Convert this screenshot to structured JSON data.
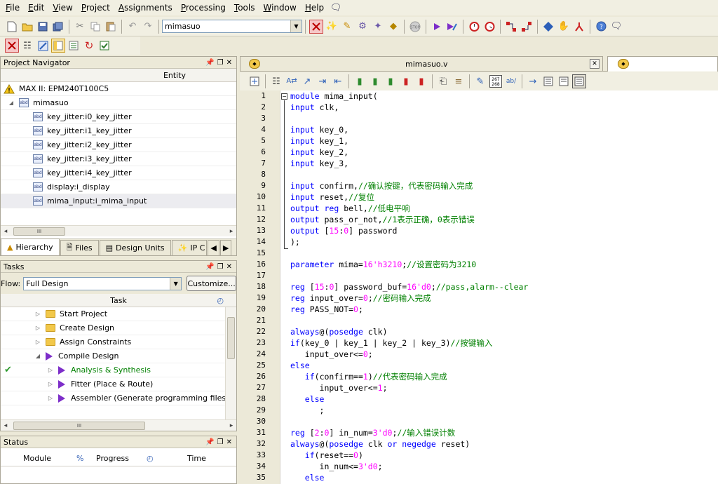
{
  "menu": [
    "File",
    "Edit",
    "View",
    "Project",
    "Assignments",
    "Processing",
    "Tools",
    "Window",
    "Help"
  ],
  "toolbar": {
    "project_combo": "mimasuo"
  },
  "project_navigator": {
    "title": "Project Navigator",
    "column": "Entity",
    "device": "MAX II: EPM240T100C5",
    "root": "mimasuo",
    "children": [
      "key_jitter:i0_key_jitter",
      "key_jitter:i1_key_jitter",
      "key_jitter:i2_key_jitter",
      "key_jitter:i3_key_jitter",
      "key_jitter:i4_key_jitter",
      "display:i_display",
      "mima_input:i_mima_input"
    ],
    "scroll_label": "III",
    "tabs": [
      "Hierarchy",
      "Files",
      "Design Units",
      "IP C"
    ]
  },
  "tasks": {
    "title": "Tasks",
    "flow_label": "Flow:",
    "flow_value": "Full Design",
    "customize_label": "Customize...",
    "column": "Task",
    "items": [
      "Start Project",
      "Create Design",
      "Assign Constraints",
      "Compile Design",
      "Analysis & Synthesis",
      "Fitter (Place & Route)",
      "Assembler (Generate programming files)"
    ],
    "scroll_label": "III"
  },
  "status": {
    "title": "Status",
    "columns": [
      "Module",
      "%",
      "Progress",
      "Time"
    ]
  },
  "editor": {
    "tab_title": "mimasuo.v",
    "lines": [
      [
        [
          "kw",
          "module"
        ],
        [
          "t",
          " mima_input("
        ]
      ],
      [
        [
          "kw",
          "input"
        ],
        [
          "t",
          " clk,"
        ]
      ],
      [],
      [
        [
          "kw",
          "input"
        ],
        [
          "t",
          " key_0,"
        ]
      ],
      [
        [
          "kw",
          "input"
        ],
        [
          "t",
          " key_1,"
        ]
      ],
      [
        [
          "kw",
          "input"
        ],
        [
          "t",
          " key_2,"
        ]
      ],
      [
        [
          "kw",
          "input"
        ],
        [
          "t",
          " key_3,"
        ]
      ],
      [],
      [
        [
          "kw",
          "input"
        ],
        [
          "t",
          " confirm,"
        ],
        [
          "cm",
          "//确认按键，代表密码输入完成"
        ]
      ],
      [
        [
          "kw",
          "input"
        ],
        [
          "t",
          " reset,"
        ],
        [
          "cm",
          "//复位"
        ]
      ],
      [
        [
          "kw",
          "output"
        ],
        [
          "t",
          " "
        ],
        [
          "kw",
          "reg"
        ],
        [
          "t",
          " bell,"
        ],
        [
          "cm",
          "//低电平响"
        ]
      ],
      [
        [
          "kw",
          "output"
        ],
        [
          "t",
          " pass_or_not,"
        ],
        [
          "cm",
          "//1表示正确，0表示错误"
        ]
      ],
      [
        [
          "kw",
          "output"
        ],
        [
          "t",
          " ["
        ],
        [
          "nm",
          "15"
        ],
        [
          "t",
          ":"
        ],
        [
          "nm",
          "0"
        ],
        [
          "t",
          "] password"
        ]
      ],
      [
        [
          "t",
          ");"
        ]
      ],
      [],
      [
        [
          "kw",
          "parameter"
        ],
        [
          "t",
          " mima="
        ],
        [
          "nm",
          "16'h3210"
        ],
        [
          "t",
          ";"
        ],
        [
          "cm",
          "//设置密码为3210"
        ]
      ],
      [],
      [
        [
          "kw",
          "reg"
        ],
        [
          "t",
          " ["
        ],
        [
          "nm",
          "15"
        ],
        [
          "t",
          ":"
        ],
        [
          "nm",
          "0"
        ],
        [
          "t",
          "] password_buf="
        ],
        [
          "nm",
          "16'd0"
        ],
        [
          "t",
          ";"
        ],
        [
          "cm",
          "//pass,alarm--clear"
        ]
      ],
      [
        [
          "kw",
          "reg"
        ],
        [
          "t",
          " input_over="
        ],
        [
          "nm",
          "0"
        ],
        [
          "t",
          ";"
        ],
        [
          "cm",
          "//密码输入完成"
        ]
      ],
      [
        [
          "kw",
          "reg"
        ],
        [
          "t",
          " PASS_NOT="
        ],
        [
          "nm",
          "0"
        ],
        [
          "t",
          ";"
        ]
      ],
      [],
      [
        [
          "kw",
          "always"
        ],
        [
          "t",
          "@("
        ],
        [
          "kw",
          "posedge"
        ],
        [
          "t",
          " clk)"
        ]
      ],
      [
        [
          "kw",
          "if"
        ],
        [
          "t",
          "(key_0 | key_1 | key_2 | key_3)"
        ],
        [
          "cm",
          "//按键输入"
        ]
      ],
      [
        [
          "t",
          "   input_over<="
        ],
        [
          "nm",
          "0"
        ],
        [
          "t",
          ";"
        ]
      ],
      [
        [
          "kw",
          "else"
        ]
      ],
      [
        [
          "t",
          "   "
        ],
        [
          "kw",
          "if"
        ],
        [
          "t",
          "(confirm=="
        ],
        [
          "nm",
          "1"
        ],
        [
          "t",
          ")"
        ],
        [
          "cm",
          "//代表密码输入完成"
        ]
      ],
      [
        [
          "t",
          "      input_over<="
        ],
        [
          "nm",
          "1"
        ],
        [
          "t",
          ";"
        ]
      ],
      [
        [
          "t",
          "   "
        ],
        [
          "kw",
          "else"
        ]
      ],
      [
        [
          "t",
          "      ;"
        ]
      ],
      [],
      [
        [
          "kw",
          "reg"
        ],
        [
          "t",
          " ["
        ],
        [
          "nm",
          "2"
        ],
        [
          "t",
          ":"
        ],
        [
          "nm",
          "0"
        ],
        [
          "t",
          "] in_num="
        ],
        [
          "nm",
          "3'd0"
        ],
        [
          "t",
          ";"
        ],
        [
          "cm",
          "//输入错误计数"
        ]
      ],
      [
        [
          "kw",
          "always"
        ],
        [
          "t",
          "@("
        ],
        [
          "kw",
          "posedge"
        ],
        [
          "t",
          " clk "
        ],
        [
          "kw",
          "or"
        ],
        [
          "t",
          " "
        ],
        [
          "kw",
          "negedge"
        ],
        [
          "t",
          " reset)"
        ]
      ],
      [
        [
          "t",
          "   "
        ],
        [
          "kw",
          "if"
        ],
        [
          "t",
          "(reset=="
        ],
        [
          "nm",
          "0"
        ],
        [
          "t",
          ")"
        ]
      ],
      [
        [
          "t",
          "      in_num<="
        ],
        [
          "nm",
          "3'd0"
        ],
        [
          "t",
          ";"
        ]
      ],
      [
        [
          "t",
          "   "
        ],
        [
          "kw",
          "else"
        ]
      ]
    ]
  },
  "colors": {
    "keyword": "#0000ff",
    "comment": "#008000",
    "number": "#ff00ff",
    "link": "#008000",
    "task_icon": "#7d2ec9"
  }
}
